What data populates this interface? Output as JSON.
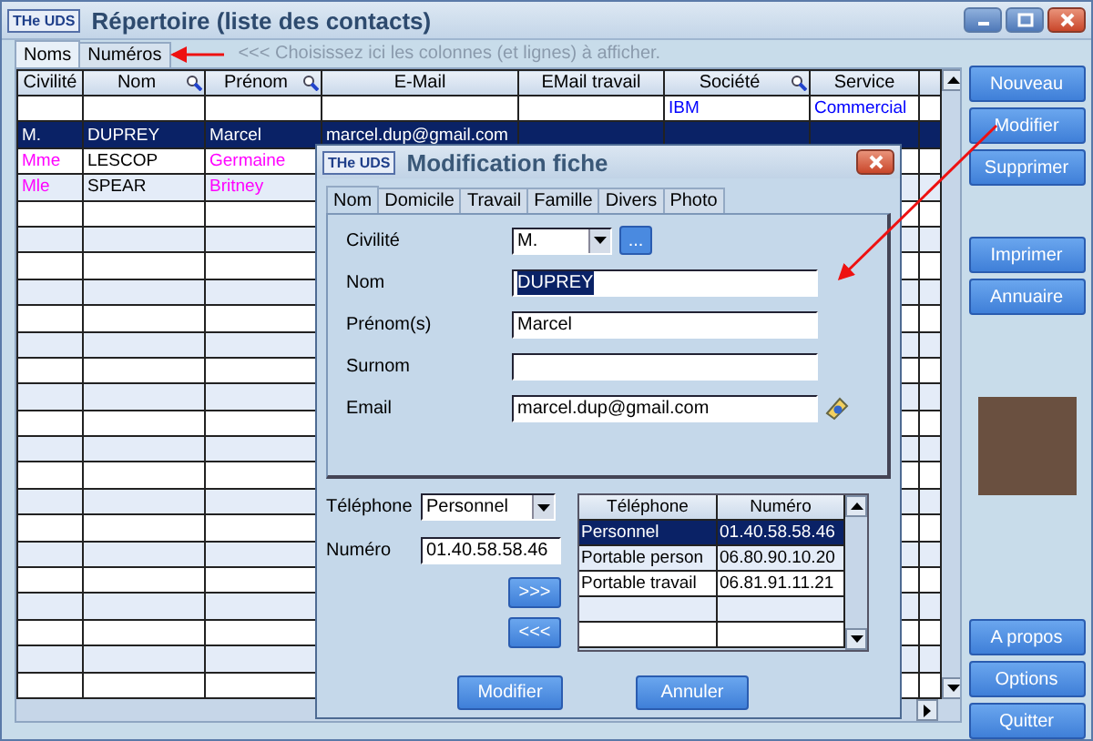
{
  "window": {
    "logo": "THe UDS",
    "title": "Répertoire (liste des contacts)"
  },
  "tabs": [
    {
      "label": "Noms",
      "selected": true
    },
    {
      "label": "Numéros",
      "selected": false
    }
  ],
  "hint": "<<< Choisissez ici les colonnes (et lignes) à afficher.",
  "table": {
    "columns": [
      {
        "label": "Civilité",
        "searchable": false
      },
      {
        "label": "Nom",
        "searchable": true
      },
      {
        "label": "Prénom",
        "searchable": true
      },
      {
        "label": "E-Mail",
        "searchable": false
      },
      {
        "label": "EMail travail",
        "searchable": false
      },
      {
        "label": "Société",
        "searchable": true
      },
      {
        "label": "Service",
        "searchable": false
      }
    ],
    "rows": [
      {
        "selected": false,
        "cells": [
          {
            "text": ""
          },
          {
            "text": ""
          },
          {
            "text": ""
          },
          {
            "text": ""
          },
          {
            "text": ""
          },
          {
            "text": "IBM",
            "color": "#0000ff"
          },
          {
            "text": "Commercial",
            "color": "#0000ff"
          }
        ]
      },
      {
        "selected": true,
        "cells": [
          {
            "text": "M."
          },
          {
            "text": "DUPREY"
          },
          {
            "text": "Marcel"
          },
          {
            "text": "marcel.dup@gmail.com"
          },
          {
            "text": ""
          },
          {
            "text": ""
          },
          {
            "text": ""
          }
        ]
      },
      {
        "selected": false,
        "cells": [
          {
            "text": "Mme",
            "color": "#ff00ff"
          },
          {
            "text": "LESCOP"
          },
          {
            "text": "Germaine",
            "color": "#ff00ff"
          },
          {
            "text": ""
          },
          {
            "text": ""
          },
          {
            "text": ""
          },
          {
            "text": ""
          }
        ]
      },
      {
        "selected": false,
        "cells": [
          {
            "text": "Mle",
            "color": "#ff00ff"
          },
          {
            "text": "SPEAR"
          },
          {
            "text": "Britney",
            "color": "#ff00ff"
          },
          {
            "text": ""
          },
          {
            "text": ""
          },
          {
            "text": ""
          },
          {
            "text": ""
          }
        ]
      }
    ]
  },
  "action_groups": [
    [
      "Nouveau",
      "Modifier",
      "Supprimer"
    ],
    [
      "Imprimer",
      "Annuaire"
    ],
    [
      "A propos",
      "Options",
      "Quitter"
    ]
  ],
  "dialog": {
    "logo": "THe UDS",
    "title": "Modification fiche",
    "tabs": [
      {
        "label": "Nom",
        "selected": true
      },
      {
        "label": "Domicile",
        "selected": false
      },
      {
        "label": "Travail",
        "selected": false
      },
      {
        "label": "Famille",
        "selected": false
      },
      {
        "label": "Divers",
        "selected": false
      },
      {
        "label": "Photo",
        "selected": false
      }
    ],
    "fields": [
      {
        "kind": "select",
        "label": "Civilité",
        "value": "M.",
        "more": "..."
      },
      {
        "kind": "text",
        "label": "Nom",
        "value": "DUPREY",
        "highlighted": true
      },
      {
        "kind": "text",
        "label": "Prénom(s)",
        "value": "Marcel"
      },
      {
        "kind": "text",
        "label": "Surnom"
      },
      {
        "kind": "email",
        "label": "Email",
        "value": "marcel.dup@gmail.com"
      }
    ],
    "phone_type": {
      "label": "Téléphone",
      "value": "Personnel"
    },
    "phone_number": {
      "label": "Numéro",
      "value": "01.40.58.58.46"
    },
    "move_buttons": [
      ">>>",
      "<<<"
    ],
    "phones": {
      "columns": [
        "Téléphone",
        "Numéro"
      ],
      "rows": [
        {
          "selected": true,
          "cells": [
            "Personnel",
            "01.40.58.58.46"
          ]
        },
        {
          "selected": false,
          "cells": [
            "Portable person",
            "06.80.90.10.20"
          ]
        },
        {
          "selected": false,
          "cells": [
            "Portable travail",
            "06.81.91.11.21"
          ]
        }
      ]
    },
    "buttons": [
      "Modifier",
      "Annuler"
    ]
  }
}
